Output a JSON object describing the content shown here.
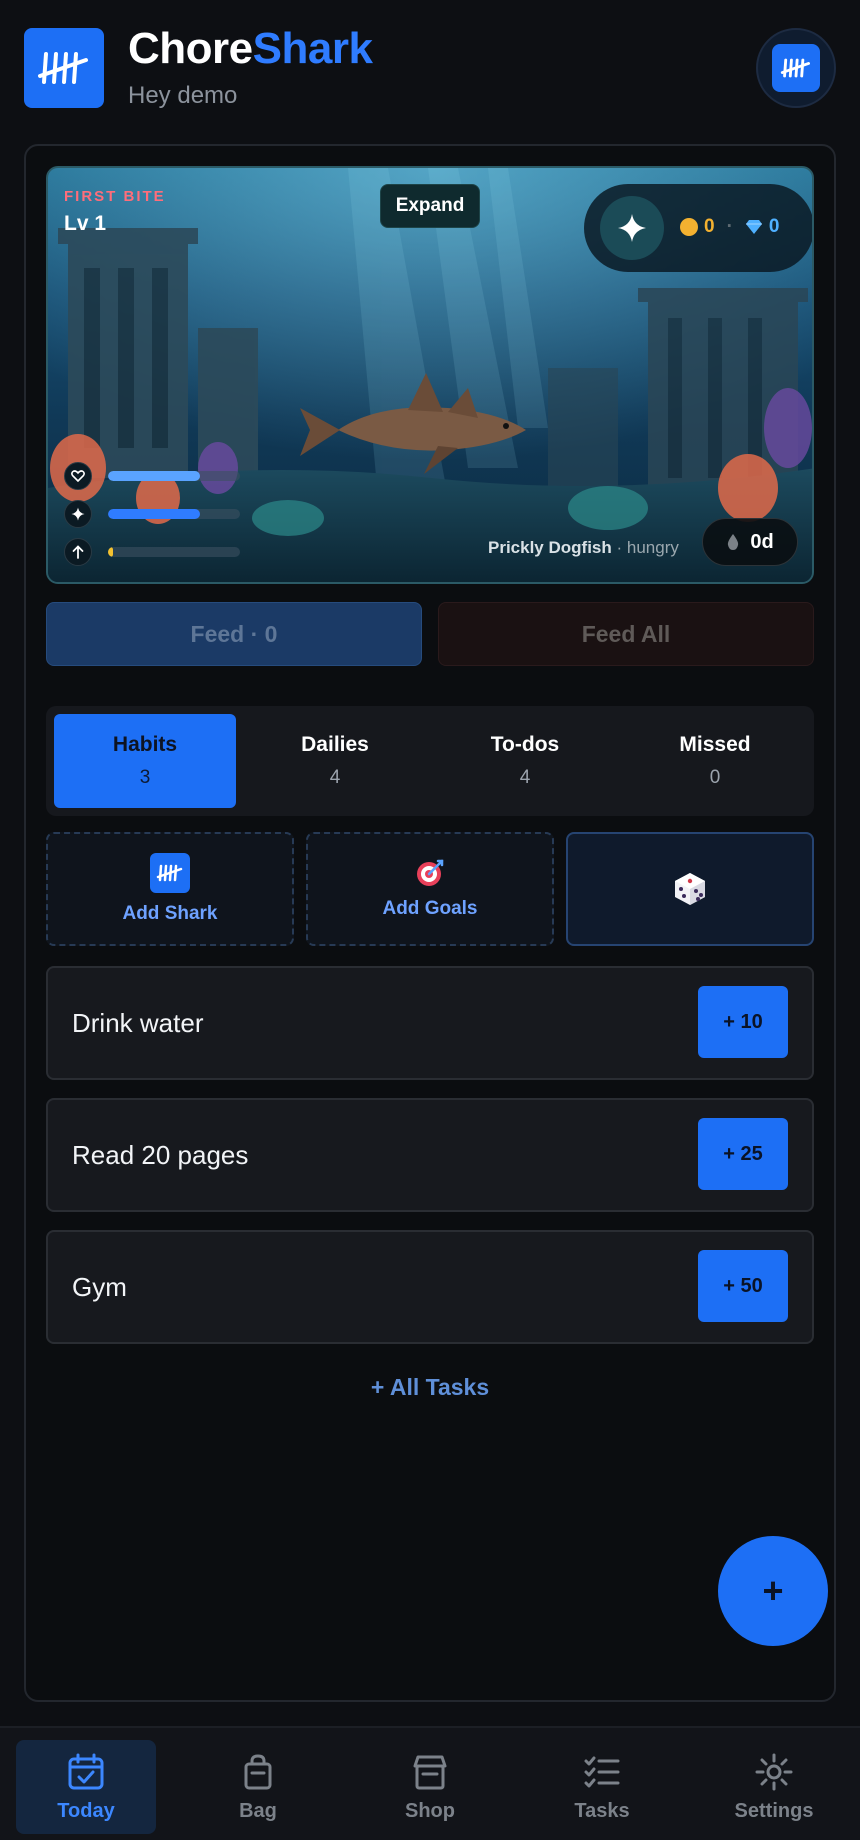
{
  "header": {
    "title_part1": "Chore",
    "title_part2": "Shark",
    "greeting": "Hey demo",
    "logo_icon": "tally-marks-icon"
  },
  "aquarium": {
    "level_tag": "FIRST BITE",
    "level": "Lv 1",
    "expand_label": "Expand",
    "coins": "0",
    "gems": "0",
    "fish_name": "Prickly Dogfish",
    "fish_status": "· hungry",
    "days": "0d",
    "stats": [
      {
        "name": "health",
        "icon": "heart-icon",
        "level": 0.7,
        "color": "#5aa3ff"
      },
      {
        "name": "energy",
        "icon": "sparkle-icon",
        "level": 0.7,
        "color": "#2f7cff"
      },
      {
        "name": "growth",
        "icon": "arrow-up-icon",
        "level": 0.04,
        "color": "#f3c130"
      }
    ]
  },
  "feed": {
    "feed_label": "Feed · 0",
    "feed_all_label": "Feed All"
  },
  "tabs": [
    {
      "label": "Habits",
      "count": "3"
    },
    {
      "label": "Dailies",
      "count": "4"
    },
    {
      "label": "To-dos",
      "count": "4"
    },
    {
      "label": "Missed",
      "count": "0"
    }
  ],
  "actions": {
    "add_shark": "Add Shark",
    "add_goals": "Add Goals"
  },
  "tasks": [
    {
      "name": "Drink water",
      "points": "+ 10"
    },
    {
      "name": "Read 20 pages",
      "points": "+ 25"
    },
    {
      "name": "Gym",
      "points": "+ 50"
    }
  ],
  "all_tasks_label": "+ All Tasks",
  "fab_label": "+",
  "nav": [
    {
      "label": "Today",
      "icon": "calendar-check-icon"
    },
    {
      "label": "Bag",
      "icon": "bag-icon"
    },
    {
      "label": "Shop",
      "icon": "store-icon"
    },
    {
      "label": "Tasks",
      "icon": "checklist-icon"
    },
    {
      "label": "Settings",
      "icon": "gear-icon"
    }
  ],
  "colors": {
    "accent": "#1d6ff5",
    "background": "#0d0f13",
    "danger_tag": "#ff6d7a",
    "coin": "#f3b130",
    "gem": "#4fb0ff"
  }
}
